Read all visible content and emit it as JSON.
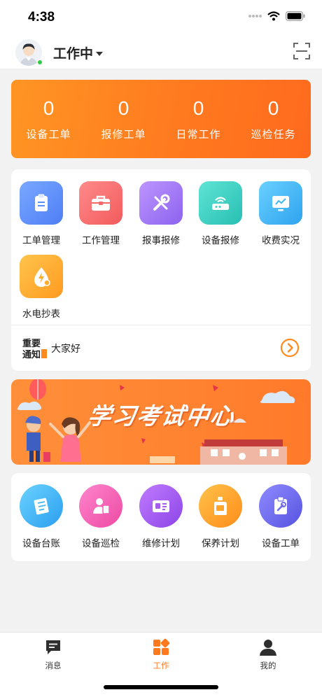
{
  "status_bar": {
    "time": "4:38"
  },
  "header": {
    "status_label": "工作中",
    "avatar_icon": "user-avatar",
    "scan_icon": "scan-icon"
  },
  "stats": [
    {
      "value": "0",
      "label": "设备工单"
    },
    {
      "value": "0",
      "label": "报修工单"
    },
    {
      "value": "0",
      "label": "日常工作"
    },
    {
      "value": "0",
      "label": "巡检任务"
    }
  ],
  "modules": [
    {
      "label": "工单管理",
      "icon": "clipboard-icon",
      "color": "#5b8ff9"
    },
    {
      "label": "工作管理",
      "icon": "briefcase-icon",
      "color": "#f8686a"
    },
    {
      "label": "报事报修",
      "icon": "tools-icon",
      "color": "#a27cf5"
    },
    {
      "label": "设备报修",
      "icon": "router-icon",
      "color": "#39d0c4"
    },
    {
      "label": "收费实况",
      "icon": "monitor-icon",
      "color": "#41b6f5"
    },
    {
      "label": "水电抄表",
      "icon": "water-electric-icon",
      "color": "#ffab2e"
    }
  ],
  "notice": {
    "logo_text": "重要通知",
    "text": "大家好"
  },
  "banner": {
    "title": "学习考试中心"
  },
  "tools": [
    {
      "label": "设备台账",
      "icon": "ledger-icon",
      "color": "#3fb4f2"
    },
    {
      "label": "设备巡检",
      "icon": "inspection-icon",
      "color": "#f55fb5"
    },
    {
      "label": "维修计划",
      "icon": "plan-card-icon",
      "color": "#a65df0"
    },
    {
      "label": "保养计划",
      "icon": "oil-bottle-icon",
      "color": "#ffa42a"
    },
    {
      "label": "设备工单",
      "icon": "work-order-icon",
      "color": "#6f6cf0"
    }
  ],
  "tabbar": [
    {
      "label": "消息",
      "icon": "message-icon",
      "active": false
    },
    {
      "label": "工作",
      "icon": "work-grid-icon",
      "active": true
    },
    {
      "label": "我的",
      "icon": "profile-icon",
      "active": false
    }
  ],
  "colors": {
    "accent": "#ff7a1f",
    "online": "#2ecc40"
  }
}
